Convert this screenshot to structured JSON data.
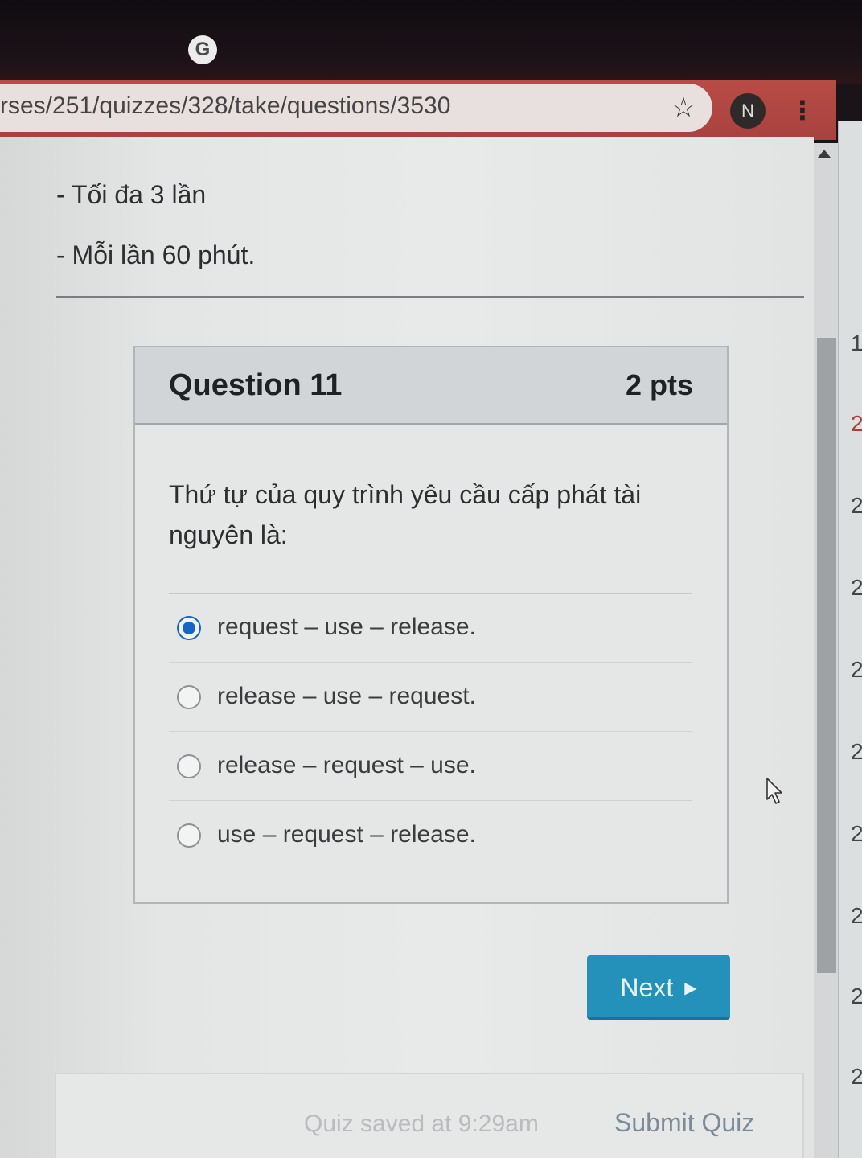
{
  "browser": {
    "url": "rses/251/quizzes/328/take/questions/3530",
    "profile_initial": "N",
    "logo_letter": "G"
  },
  "notes": {
    "line1": "- Tối đa 3 lần",
    "line2": "- Mỗi lần 60 phút."
  },
  "question": {
    "title": "Question 11",
    "points": "2 pts",
    "text": "Thứ tự của quy trình yêu cầu cấp phát tài nguyên là:",
    "options": [
      {
        "label": "request – use – release.",
        "selected": true
      },
      {
        "label": "release – use – request.",
        "selected": false
      },
      {
        "label": "release – request – use.",
        "selected": false
      },
      {
        "label": "use – request – release.",
        "selected": false
      }
    ]
  },
  "navigation": {
    "next_label": "Next"
  },
  "footer": {
    "saved_text": "Quiz saved at 9:29am",
    "submit_label": "Submit Quiz"
  },
  "side_panel": {
    "numbers": [
      "1",
      "2",
      "2",
      "2",
      "2",
      "2",
      "2",
      "2",
      "2",
      "2"
    ]
  },
  "colors": {
    "accent_blue": "#1466c8",
    "button_teal": "#2391ba",
    "toolbar_red": "#b94b45"
  }
}
